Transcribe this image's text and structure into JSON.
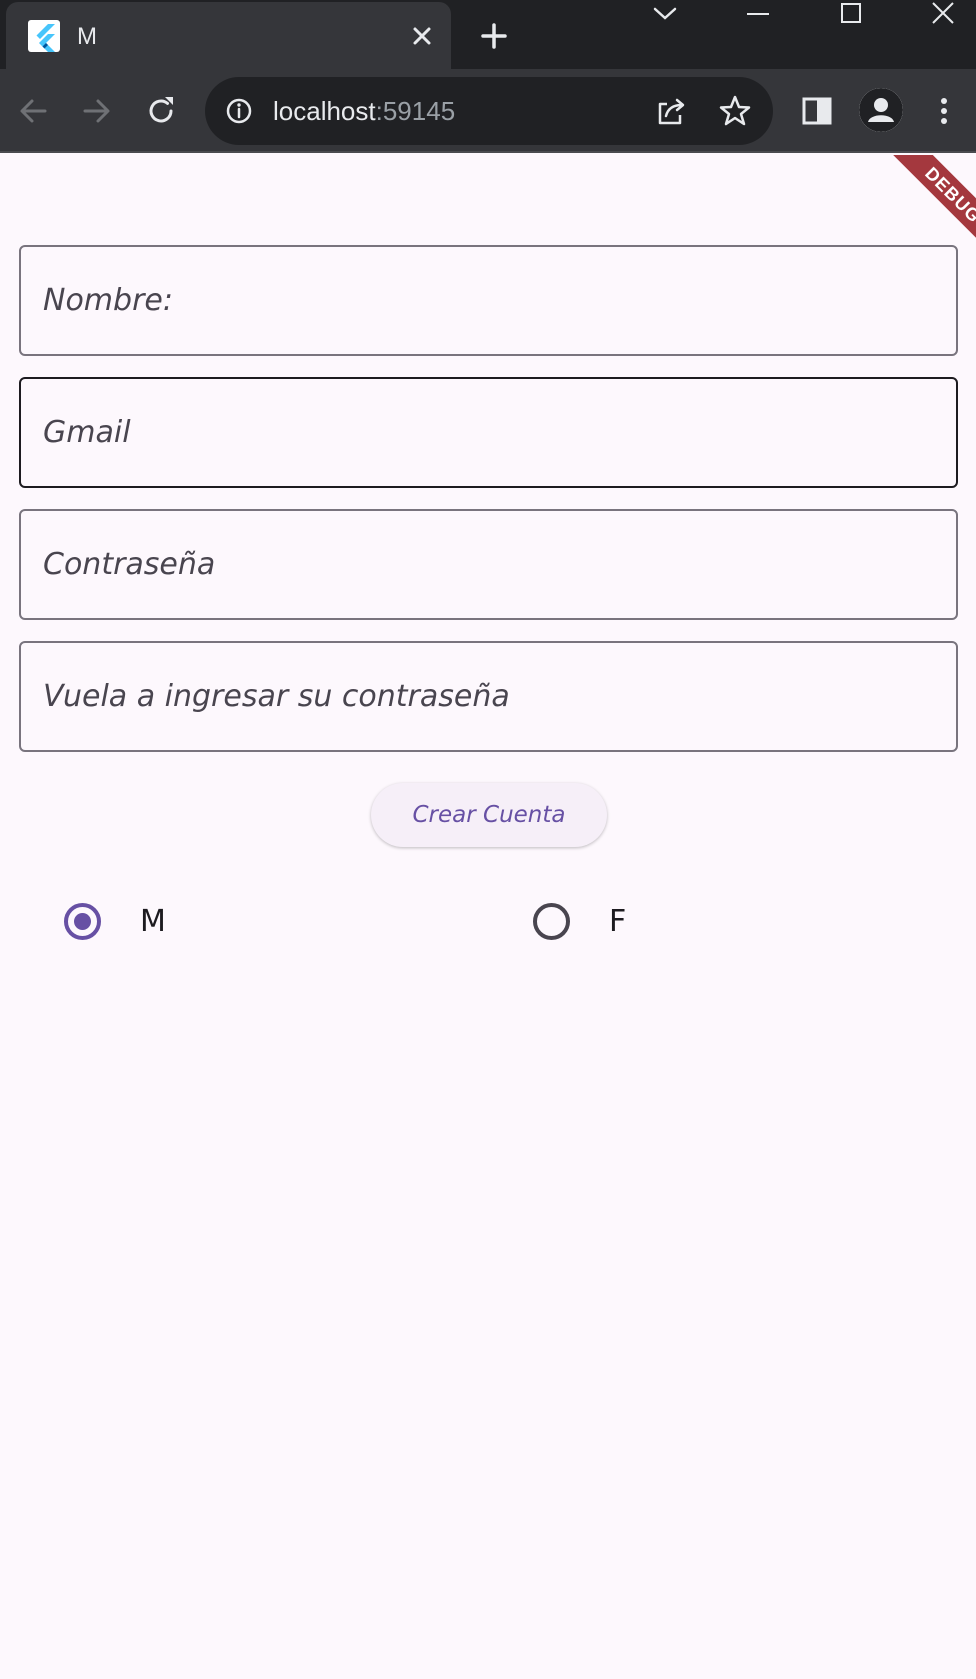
{
  "browser": {
    "tab_title": "M",
    "url_host": "localhost",
    "url_port": ":59145"
  },
  "debug_banner": "DEBUG",
  "form": {
    "nombre_placeholder": "Nombre:",
    "gmail_placeholder": "Gmail",
    "password_placeholder": "Contraseña",
    "confirm_password_placeholder": "Vuela a ingresar su contraseña",
    "submit_label": "Crear Cuenta"
  },
  "gender": {
    "options": [
      {
        "label": "M",
        "selected": true
      },
      {
        "label": "F",
        "selected": false
      }
    ]
  },
  "colors": {
    "accent": "#6750a4",
    "chrome_dark": "#202124",
    "chrome_toolbar": "#35363a",
    "debug_ribbon": "#a4383e",
    "background": "#fdf8fd"
  }
}
